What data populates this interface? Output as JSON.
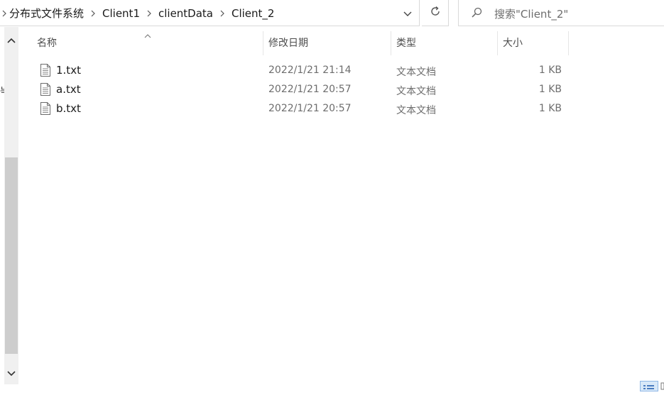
{
  "address_bar": {
    "breadcrumbs": [
      "分布式文件系统",
      "Client1",
      "clientData",
      "Client_2"
    ]
  },
  "search": {
    "placeholder": "搜索\"Client_2\""
  },
  "nav_stub": {
    "text": "늑"
  },
  "columns": {
    "name": "名称",
    "modified": "修改日期",
    "type": "类型",
    "size": "大小"
  },
  "files": [
    {
      "name": "1.txt",
      "modified": "2022/1/21 21:14",
      "type": "文本文档",
      "size": "1 KB"
    },
    {
      "name": "a.txt",
      "modified": "2022/1/21 20:57",
      "type": "文本文档",
      "size": "1 KB"
    },
    {
      "name": "b.txt",
      "modified": "2022/1/21 20:57",
      "type": "文本文档",
      "size": "1 KB"
    }
  ],
  "icons": {
    "file": "text-file-icon",
    "search": "search-icon",
    "refresh": "refresh-icon",
    "dropdown": "chevron-down-icon"
  }
}
